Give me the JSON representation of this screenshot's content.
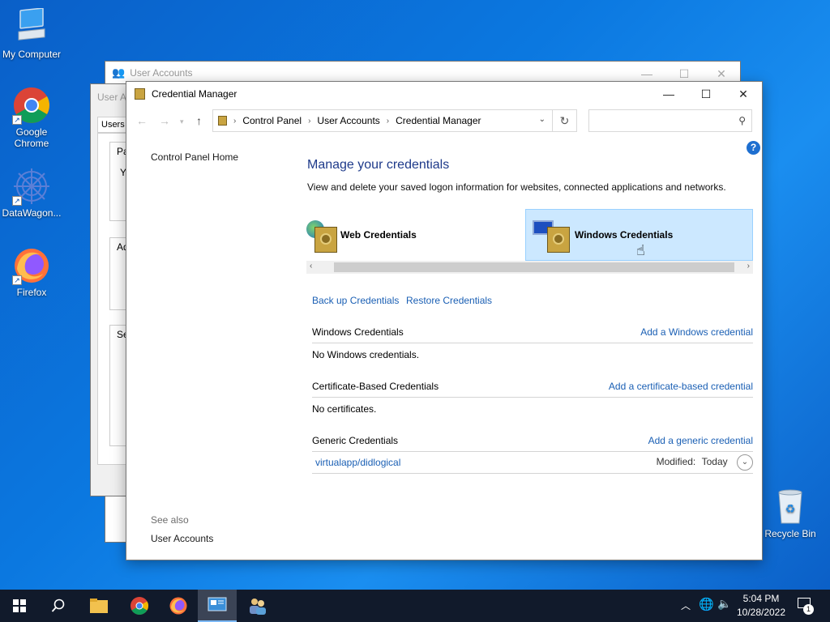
{
  "desktop": {
    "icons": [
      {
        "label": "My Computer"
      },
      {
        "label": "Google Chrome"
      },
      {
        "label": "DataWagon..."
      },
      {
        "label": "Firefox"
      },
      {
        "label": "Recycle Bin"
      }
    ]
  },
  "bg_window": {
    "title": "User Accounts",
    "side_title": "User A",
    "tab": "Users",
    "fragments": [
      "Pa",
      "Yo",
      "Ad",
      "Se"
    ]
  },
  "window": {
    "title": "Credential Manager",
    "breadcrumb": [
      "Control Panel",
      "User Accounts",
      "Credential Manager"
    ],
    "search_placeholder": "",
    "sidebar": {
      "home": "Control Panel Home",
      "see_also_label": "See also",
      "see_also_link": "User Accounts"
    },
    "help_label": "?",
    "heading": "Manage your credentials",
    "description": "View and delete your saved logon information for websites, connected applications and networks.",
    "tiles": [
      {
        "label": "Web Credentials",
        "selected": false
      },
      {
        "label": "Windows Credentials",
        "selected": true
      }
    ],
    "actions": {
      "backup": "Back up Credentials",
      "restore": "Restore Credentials"
    },
    "sections": [
      {
        "title": "Windows Credentials",
        "add": "Add a Windows credential",
        "empty": "No Windows credentials."
      },
      {
        "title": "Certificate-Based Credentials",
        "add": "Add a certificate-based credential",
        "empty": "No certificates."
      },
      {
        "title": "Generic Credentials",
        "add": "Add a generic credential"
      }
    ],
    "generic_items": [
      {
        "name": "virtualapp/didlogical",
        "modified_label": "Modified:",
        "modified_value": "Today"
      }
    ]
  },
  "taskbar": {
    "time": "5:04 PM",
    "date": "10/28/2022",
    "notification_count": "1"
  },
  "colors": {
    "accent": "#1a5fb4",
    "heading": "#1e3a8a",
    "selected_tile": "#cce8ff",
    "taskbar": "#111a2b"
  }
}
